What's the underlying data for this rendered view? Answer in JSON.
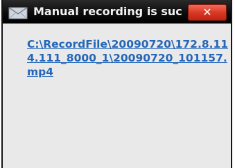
{
  "window": {
    "title": "Manual recording is suc",
    "close_label": "✕"
  },
  "content": {
    "file_link": "C:\\RecordFile\\20090720\\172.8.114.111_8000_1\\20090720_101157.mp4"
  },
  "colors": {
    "titlebar": "#0c0c0c",
    "close_button": "#d93a26",
    "link": "#2466b8",
    "background": "#e9e9e9"
  },
  "icons": {
    "title_icon": "envelope-icon"
  }
}
